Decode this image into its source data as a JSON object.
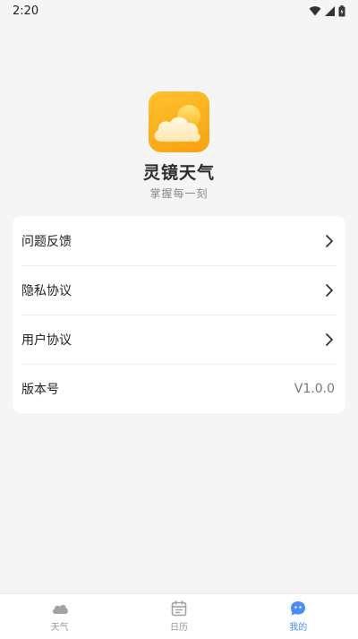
{
  "status_bar": {
    "time": "2:20",
    "icons": [
      "wifi-icon",
      "signal-icon",
      "battery-icon"
    ]
  },
  "app": {
    "logo_icon": "sun-cloud-icon",
    "name": "灵镜天气",
    "slogan": "掌握每一刻"
  },
  "menu": {
    "items": [
      {
        "label": "问题反馈",
        "icon": "chevron-right-icon"
      },
      {
        "label": "隐私协议",
        "icon": "chevron-right-icon"
      },
      {
        "label": "用户协议",
        "icon": "chevron-right-icon"
      }
    ],
    "version": {
      "label": "版本号",
      "value": "V1.0.0"
    }
  },
  "tabs": [
    {
      "label": "天气",
      "icon": "cloud-icon",
      "active": false
    },
    {
      "label": "日历",
      "icon": "calendar-icon",
      "active": false
    },
    {
      "label": "我的",
      "icon": "profile-chat-icon",
      "active": true
    }
  ],
  "colors": {
    "background": "#f5f5f5",
    "logo_gradient_start": "#ffc12e",
    "logo_gradient_end": "#f9a10f",
    "tab_active": "#4a8df8",
    "tab_inactive": "#9a9a9a"
  }
}
